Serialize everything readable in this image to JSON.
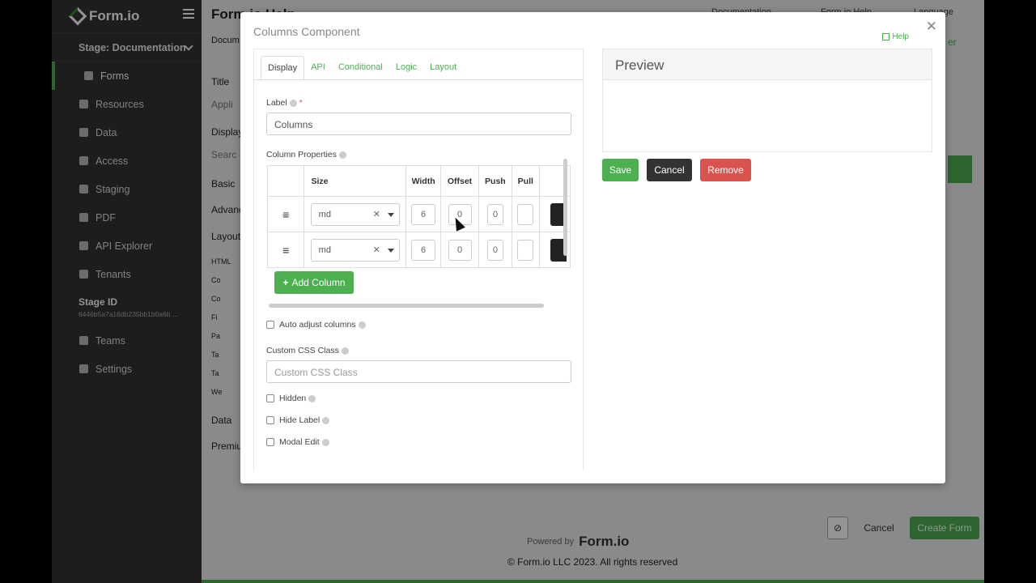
{
  "sidebar": {
    "brand": "Form.io",
    "stage": "Stage: Documentation",
    "items": [
      {
        "label": "Forms",
        "icon": "list-icon"
      },
      {
        "label": "Resources",
        "icon": "table-icon"
      },
      {
        "label": "Data",
        "icon": "database-icon"
      },
      {
        "label": "Access",
        "icon": "shield-icon"
      },
      {
        "label": "Staging",
        "icon": "folder-icon"
      },
      {
        "label": "PDF",
        "icon": "file-pdf-icon"
      },
      {
        "label": "API Explorer",
        "icon": "location-icon"
      },
      {
        "label": "Tenants",
        "icon": "sitemap-icon"
      }
    ],
    "stage_id_label": "Stage ID",
    "stage_id_value": "6446b5a7a16db235bb1b0a6b ...",
    "items2": [
      {
        "label": "Teams",
        "icon": "users-icon"
      },
      {
        "label": "Settings",
        "icon": "gear-icon"
      }
    ]
  },
  "background": {
    "title": "Form.io Help",
    "top_links": [
      "Documentation",
      "Form.io Help",
      "Language"
    ],
    "crumb": "Docum",
    "title_label": "Title",
    "title_value": "Appli",
    "display_label": "Display",
    "search_placeholder": "Searc",
    "groups": [
      "Basic",
      "Advanced",
      "Layout",
      "Data",
      "Premium"
    ],
    "layout_items": [
      "HTML",
      "Co",
      "Co",
      "Fi",
      "Pa",
      "Ta",
      "Ta",
      "We"
    ],
    "new_window_label": "er",
    "footer_powered": "Powered by",
    "footer_brand": "Form.io",
    "copyright": "© Form.io LLC 2023. All rights reserved",
    "cancel_label": "Cancel",
    "create_label": "Create Form"
  },
  "modal": {
    "title": "Columns Component",
    "help": "Help",
    "tabs": [
      "Display",
      "API",
      "Conditional",
      "Logic",
      "Layout"
    ],
    "label_label": "Label",
    "label_value": "Columns",
    "column_props_label": "Column Properties",
    "headers": [
      "Size",
      "Width",
      "Offset",
      "Push",
      "Pull"
    ],
    "rows": [
      {
        "size": "md",
        "width": "6",
        "offset": "0",
        "push": "0",
        "pull": ""
      },
      {
        "size": "md",
        "width": "6",
        "offset": "0",
        "push": "0",
        "pull": ""
      }
    ],
    "add_column": "Add Column",
    "auto_adjust": "Auto adjust columns",
    "custom_css_label": "Custom CSS Class",
    "custom_css_placeholder": "Custom CSS Class",
    "hidden": "Hidden",
    "hide_label": "Hide Label",
    "modal_edit": "Modal Edit",
    "preview_title": "Preview",
    "save": "Save",
    "cancel": "Cancel",
    "remove": "Remove"
  },
  "colors": {
    "green": "#4caf50",
    "red": "#d9534f",
    "dark": "#333333"
  }
}
